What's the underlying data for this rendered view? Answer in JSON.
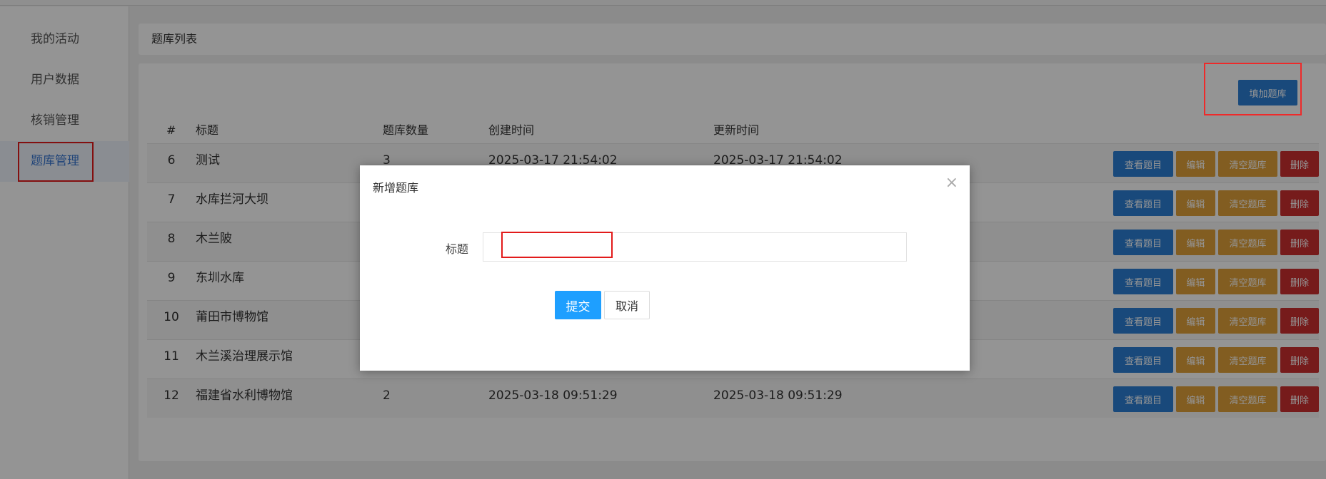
{
  "sidebar": {
    "items": [
      {
        "label": "我的活动"
      },
      {
        "label": "用户数据"
      },
      {
        "label": "核销管理"
      },
      {
        "label": "题库管理"
      }
    ]
  },
  "panel": {
    "title": "题库列表",
    "add_label": "填加题库"
  },
  "table": {
    "headers": {
      "idx": "#",
      "title": "标题",
      "count": "题库数量",
      "created": "创建时间",
      "updated": "更新时间"
    },
    "rows": [
      {
        "idx": "6",
        "title": "测试",
        "count": "3",
        "created": "2025-03-17 21:54:02",
        "updated": "2025-03-17 21:54:02"
      },
      {
        "idx": "7",
        "title": "水库拦河大坝",
        "count": "",
        "created": "",
        "updated": ""
      },
      {
        "idx": "8",
        "title": "木兰陂",
        "count": "",
        "created": "",
        "updated": ""
      },
      {
        "idx": "9",
        "title": "东圳水库",
        "count": "",
        "created": "",
        "updated": ""
      },
      {
        "idx": "10",
        "title": "莆田市博物馆",
        "count": "",
        "created": "",
        "updated": ""
      },
      {
        "idx": "11",
        "title": "木兰溪治理展示馆",
        "count": "",
        "created": "",
        "updated": ""
      },
      {
        "idx": "12",
        "title": "福建省水利博物馆",
        "count": "2",
        "created": "2025-03-18 09:51:29",
        "updated": "2025-03-18 09:51:29"
      }
    ],
    "actions": {
      "view": "查看题目",
      "edit": "编辑",
      "clear": "清空题库",
      "delete": "删除"
    }
  },
  "modal": {
    "title": "新增题库",
    "close": "×",
    "field_label": "标题",
    "field_value": "",
    "submit": "提交",
    "cancel": "取消"
  },
  "colors": {
    "primary": "#2b7fd5",
    "warning": "#e0a03a",
    "danger": "#cc2f2f",
    "submit": "#1e9fff",
    "highlight": "#e21b1b"
  }
}
